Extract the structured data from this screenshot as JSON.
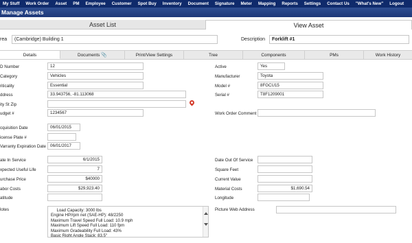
{
  "nav": [
    "My Stuff",
    "Work Order",
    "Asset",
    "PM",
    "Employee",
    "Customer",
    "Spot Buy",
    "Inventory",
    "Document",
    "Signature",
    "Meter",
    "Mapping",
    "Reports",
    "Settings",
    "Contact Us",
    "\"What's New\"",
    "Logout"
  ],
  "page_title": "Manage Assets",
  "main_tabs": {
    "asset_list": "Asset List",
    "view_asset": "View Asset"
  },
  "area": {
    "label": "rea",
    "value": "(Cambridge) Building 1"
  },
  "description": {
    "label": "Description",
    "value": "Forklift #1"
  },
  "sub_tabs": {
    "details": "Details",
    "documents": "Documents",
    "print_view": "Print/View Settings",
    "tree": "Tree",
    "components": "Components",
    "pms": "PMs",
    "work_history": "Work History"
  },
  "left_fields": {
    "id_number": {
      "label": "D Number",
      "value": "12"
    },
    "category": {
      "label": "Category",
      "value": "Vehicles"
    },
    "criticality": {
      "label": "riticality",
      "value": "Essential"
    },
    "address": {
      "label": "ddress",
      "value": "33.943756, -81.113068"
    },
    "city_st_zip": {
      "label": "ity St Zip",
      "value": ""
    },
    "budget": {
      "label": "udget #",
      "value": "1234567"
    },
    "acquisition_date": {
      "label": "cquisition Date",
      "value": "06/01/2015"
    },
    "license_plate": {
      "label": "icense Plate #",
      "value": ""
    },
    "warranty_expiration": {
      "label": "Varranty Expiration Date",
      "value": "06/01/2017"
    },
    "date_in_service": {
      "label": "ate In Service",
      "value": "6/1/2015"
    },
    "expected_useful_life": {
      "label": "xpected Useful Life",
      "value": "7"
    },
    "purchase_price": {
      "label": "urchase Price",
      "value": "$40000"
    },
    "labor_costs": {
      "label": "abor Costs",
      "value": "$29,923.40"
    },
    "latitude": {
      "label": "atitude",
      "value": ""
    },
    "notes": {
      "label": "lotes",
      "value": "     Load Capacity: 3000 lbs\nEngine HP/rpm net (SAE-HP): 48/2250\nMaximum Travel Speed Full Load: 10.9 mph\nMaximum Lift Speed Full Load: 110 fpm\nMaximum Gradeability Full Load: 43%\nBasic Right Angle Stack: 83.5\""
    }
  },
  "right_fields": {
    "active": {
      "label": "Active",
      "value": "Yes"
    },
    "manufacturer": {
      "label": "Manufacturer",
      "value": "Toyota"
    },
    "model": {
      "label": "Model #",
      "value": "8FGCU15"
    },
    "serial": {
      "label": "Serial #",
      "value": "T8F1209001"
    },
    "work_order_comment": {
      "label": "Work Order Comment",
      "value": ""
    },
    "date_out_of_service": {
      "label": "Date Out Of Service",
      "value": ""
    },
    "square_feet": {
      "label": "Square Feet",
      "value": ""
    },
    "current_value": {
      "label": "Current Value",
      "value": ""
    },
    "material_costs": {
      "label": "Material Costs",
      "value": "$1,690.54"
    },
    "longitude": {
      "label": "Longitude",
      "value": ""
    },
    "picture_web_address": {
      "label": "Picture Web Address",
      "value": ""
    }
  },
  "icons": {
    "map_pin": "map-pin-icon",
    "attachment": "paperclip-icon"
  },
  "colors": {
    "nav_bg": "#0f2a6b",
    "title_bg": "#2f4f92",
    "pin": "#d43a2a"
  }
}
